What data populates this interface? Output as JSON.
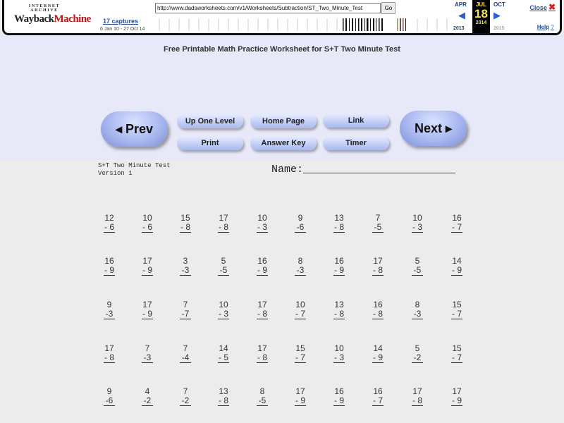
{
  "wayback": {
    "logo_top": "INTERNET ARCHIVE",
    "logo_way": "Wayback",
    "logo_machine": "Machine",
    "captures_link": "17 captures",
    "capture_range": "6 Jan 10 - 27 Oct 14",
    "url": "http://www.dadsworksheets.com/v1/Worksheets/Subtraction/ST_Two_Minute_Test",
    "go_label": "Go",
    "prev_month": "APR",
    "current_month": "JUL",
    "next_month": "OCT",
    "current_day": "18",
    "prev_year": "2013",
    "current_year": "2014",
    "next_year": "2015",
    "close_label": "Close",
    "help_label": "Help"
  },
  "header": {
    "title": "Free Printable Math Practice Worksheet for S+T Two Minute Test",
    "prev_label": "◂ Prev",
    "next_label": "Next ▸",
    "buttons": [
      "Up One Level",
      "Home Page",
      "Link",
      "Print",
      "Answer Key",
      "Timer"
    ]
  },
  "worksheet": {
    "title_line1": "S+T Two Minute Test",
    "title_line2": "Version 1",
    "name_label": "Name:________________________",
    "rows": [
      [
        [
          "12",
          "- 6"
        ],
        [
          "10",
          "- 6"
        ],
        [
          "15",
          "- 8"
        ],
        [
          "17",
          "- 8"
        ],
        [
          "10",
          "- 3"
        ],
        [
          "9",
          "-6"
        ],
        [
          "13",
          "- 8"
        ],
        [
          "7",
          "-5"
        ],
        [
          "10",
          "- 3"
        ],
        [
          "16",
          "- 7"
        ]
      ],
      [
        [
          "16",
          "- 9"
        ],
        [
          "17",
          "- 9"
        ],
        [
          "3",
          "-3"
        ],
        [
          "5",
          "-5"
        ],
        [
          "16",
          "- 9"
        ],
        [
          "8",
          "-3"
        ],
        [
          "16",
          "- 9"
        ],
        [
          "17",
          "- 8"
        ],
        [
          "5",
          "-5"
        ],
        [
          "14",
          "- 9"
        ]
      ],
      [
        [
          "9",
          "-3"
        ],
        [
          "17",
          "- 9"
        ],
        [
          "7",
          "-7"
        ],
        [
          "10",
          "- 3"
        ],
        [
          "17",
          "- 8"
        ],
        [
          "10",
          "- 7"
        ],
        [
          "13",
          "- 8"
        ],
        [
          "16",
          "- 8"
        ],
        [
          "8",
          "-3"
        ],
        [
          "15",
          "- 7"
        ]
      ],
      [
        [
          "17",
          "- 8"
        ],
        [
          "7",
          "-3"
        ],
        [
          "7",
          "-4"
        ],
        [
          "14",
          "- 5"
        ],
        [
          "17",
          "- 8"
        ],
        [
          "15",
          "- 7"
        ],
        [
          "10",
          "- 3"
        ],
        [
          "14",
          "- 9"
        ],
        [
          "5",
          "-2"
        ],
        [
          "15",
          "- 7"
        ]
      ],
      [
        [
          "9",
          "-6"
        ],
        [
          "4",
          "-2"
        ],
        [
          "7",
          "-2"
        ],
        [
          "13",
          "- 8"
        ],
        [
          "8",
          "-5"
        ],
        [
          "17",
          "- 9"
        ],
        [
          "16",
          "- 9"
        ],
        [
          "16",
          "- 7"
        ],
        [
          "17",
          "- 8"
        ],
        [
          "17",
          "- 9"
        ]
      ]
    ]
  }
}
